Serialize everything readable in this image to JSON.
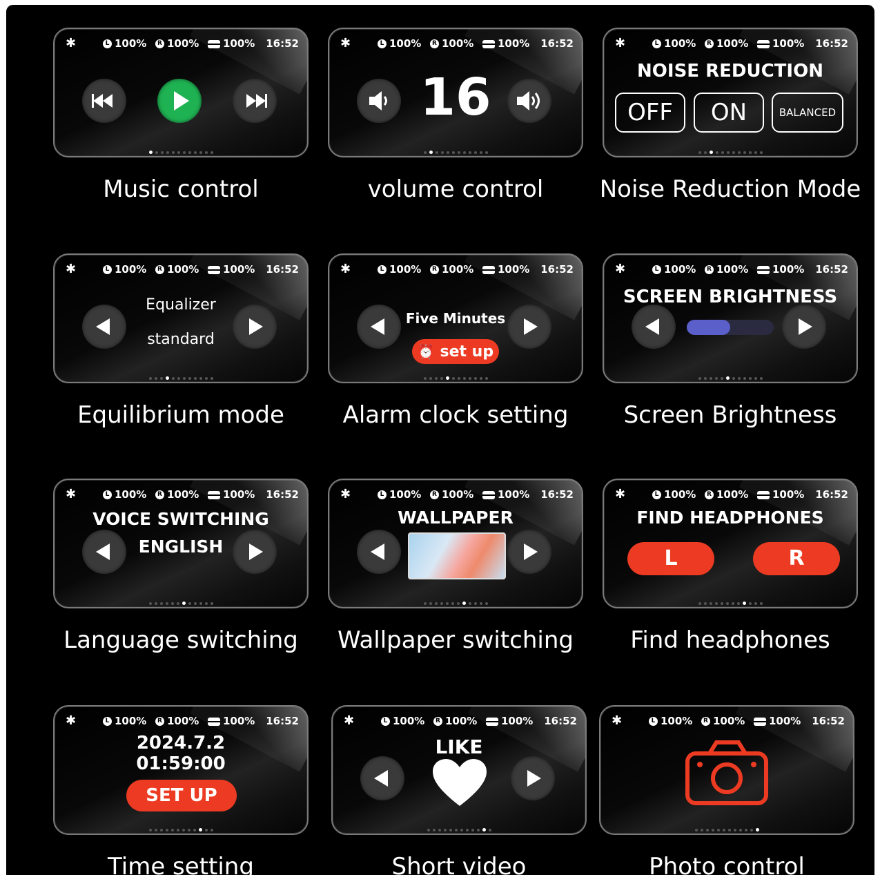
{
  "status": {
    "battery_left": "100%",
    "battery_right": "100%",
    "battery_case": "100%",
    "time": "16:52",
    "left_icon": "L",
    "right_icon": "R"
  },
  "tiles": [
    {
      "caption": "Music control",
      "active_dot": 0
    },
    {
      "caption": "volume control",
      "value": "16",
      "active_dot": 1
    },
    {
      "caption": "Noise Reduction Mode",
      "title": "NOISE REDUCTION",
      "options": [
        "OFF",
        "ON",
        "BALANCED"
      ],
      "active_dot": 2
    },
    {
      "caption": "Equilibrium mode",
      "line1": "Equalizer",
      "line2": "standard",
      "active_dot": 3
    },
    {
      "caption": "Alarm clock setting",
      "line1": "Five Minutes",
      "button": "set up",
      "active_dot": 4
    },
    {
      "caption": "Screen Brightness",
      "title": "SCREEN BRIGHTNESS",
      "level": 0.5,
      "active_dot": 5
    },
    {
      "caption": "Language switching",
      "title": "VOICE SWITCHING",
      "line2": "ENGLISH",
      "active_dot": 6
    },
    {
      "caption": "Wallpaper switching",
      "title": "WALLPAPER",
      "active_dot": 7
    },
    {
      "caption": "Find headphones",
      "title": "FIND HEADPHONES",
      "left": "L",
      "right": "R",
      "active_dot": 8
    },
    {
      "caption": "Time setting",
      "date": "2024.7.2",
      "clock": "01:59:00",
      "button": "SET UP",
      "active_dot": 9
    },
    {
      "caption": "Short video",
      "title": "LIKE",
      "active_dot": 10
    },
    {
      "caption": "Photo control",
      "active_dot": 11
    }
  ],
  "colors": {
    "play": "#1fb253",
    "accent_red": "#ec3b22",
    "brightness_bar": "#5a5fc9",
    "background": "#000000"
  }
}
